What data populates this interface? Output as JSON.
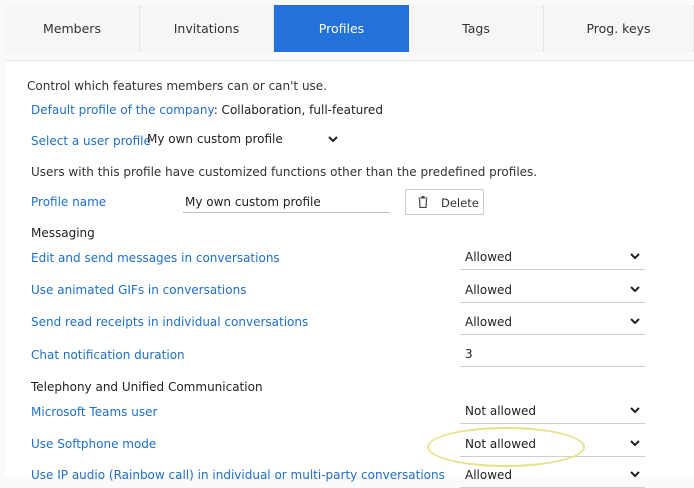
{
  "tabs": [
    {
      "label": "Members"
    },
    {
      "label": "Invitations"
    },
    {
      "label": "Profiles"
    },
    {
      "label": "Tags"
    },
    {
      "label": "Prog. keys"
    }
  ],
  "active_tab": "Profiles",
  "intro": "Control which features members can or can't use.",
  "default_profile": {
    "label": "Default profile of the company",
    "value": ": Collaboration, full-featured"
  },
  "select_profile": {
    "label": "Select a user profile",
    "value": "My own custom profile"
  },
  "custom_note": "Users with this profile have customized functions other than the predefined profiles.",
  "profile_name": {
    "label": "Profile name",
    "value": "My own custom profile"
  },
  "delete_label": "Delete",
  "messaging": {
    "heading": "Messaging",
    "rows": [
      {
        "label": "Edit and send messages in conversations",
        "value": "Allowed"
      },
      {
        "label": "Use animated GIFs in conversations",
        "value": "Allowed"
      },
      {
        "label": "Send read receipts in individual conversations",
        "value": "Allowed"
      },
      {
        "label": "Chat notification duration",
        "value": "3"
      }
    ]
  },
  "telephony": {
    "heading": "Telephony and Unified Communication",
    "rows": [
      {
        "label": "Microsoft Teams user",
        "value": "Not allowed"
      },
      {
        "label": "Use Softphone mode",
        "value": "Not allowed"
      },
      {
        "label": "Use IP audio (Rainbow call) in individual or multi-party conversations",
        "value": "Allowed"
      }
    ]
  },
  "colors": {
    "accent": "#2371da",
    "link": "#1f6fc9",
    "highlight": "#e6e28a"
  }
}
